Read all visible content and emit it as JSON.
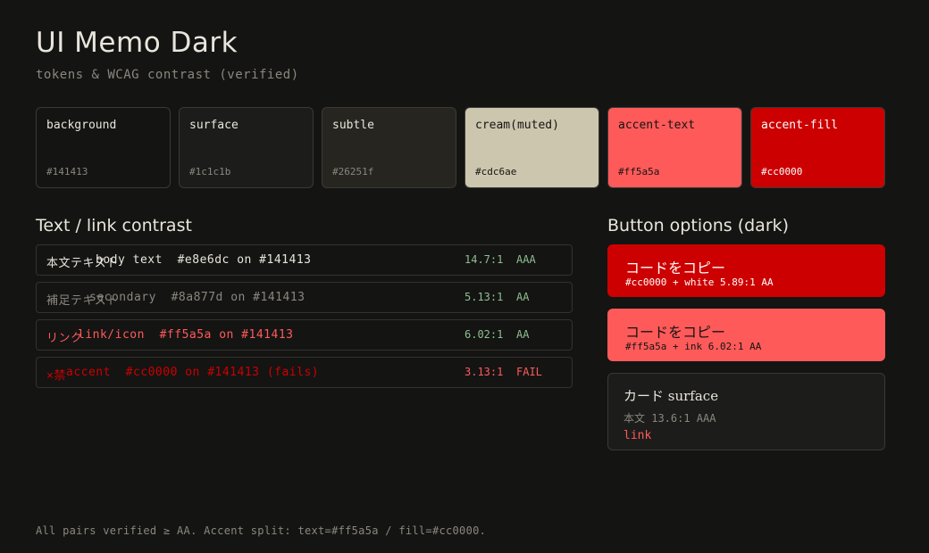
{
  "header": {
    "title": "UI Memo Dark",
    "subtitle": "tokens & WCAG contrast (verified)"
  },
  "swatches": [
    {
      "name": "background",
      "hex": "#141413",
      "color": "#141413",
      "text": "#e8e6dc",
      "hex_text": "#8a877d"
    },
    {
      "name": "surface",
      "hex": "#1c1c1b",
      "color": "#1c1c1b",
      "text": "#e8e6dc",
      "hex_text": "#8a877d"
    },
    {
      "name": "subtle",
      "hex": "#26251f",
      "color": "#26251f",
      "text": "#e8e6dc",
      "hex_text": "#8a877d"
    },
    {
      "name": "cream(muted)",
      "hex": "#cdc6ae",
      "color": "#cdc6ae",
      "text": "#141413",
      "hex_text": "#141413"
    },
    {
      "name": "accent-text",
      "hex": "#ff5a5a",
      "color": "#ff5a5a",
      "text": "#141413",
      "hex_text": "#141413"
    },
    {
      "name": "accent-fill",
      "hex": "#cc0000",
      "color": "#cc0000",
      "text": "#ffffff",
      "hex_text": "#ffffff"
    }
  ],
  "text_contrast": {
    "title": "Text / link contrast",
    "rows": [
      {
        "sample": "本文テキスト",
        "desc": "body text  #e8e6dc on #141413",
        "ratio": "14.7:1",
        "grade": "AAA",
        "color": "#e8e6dc",
        "grade_color": "#8fbf8f"
      },
      {
        "sample": "補足テキスト",
        "desc": "secondary  #8a877d on #141413",
        "ratio": "5.13:1",
        "grade": "AA",
        "color": "#8a877d",
        "grade_color": "#8fbf8f"
      },
      {
        "sample": "リンク",
        "desc": "link/icon  #ff5a5a on #141413",
        "ratio": "6.02:1",
        "grade": "AA",
        "color": "#ff5a5a",
        "grade_color": "#8fbf8f"
      },
      {
        "sample": "×禁",
        "desc": "accent  #cc0000 on #141413 (fails)",
        "ratio": "3.13:1",
        "grade": "FAIL",
        "color": "#cc0000",
        "grade_color": "#ff5a5a"
      }
    ]
  },
  "buttons": {
    "title": "Button options (dark)",
    "items": [
      {
        "label": "コードをコピー",
        "meta": "#cc0000 + white  5.89:1 AA",
        "bg": "#cc0000",
        "fg": "#ffffff"
      },
      {
        "label": "コードをコピー",
        "meta": "#ff5a5a + ink  6.02:1 AA",
        "bg": "#ff5a5a",
        "fg": "#141413"
      }
    ],
    "card": {
      "title": "カード surface",
      "meta": "本文 13.6:1 AAA",
      "link": "link"
    }
  },
  "footer": "All pairs verified ≥ AA. Accent split: text=#ff5a5a / fill=#cc0000."
}
